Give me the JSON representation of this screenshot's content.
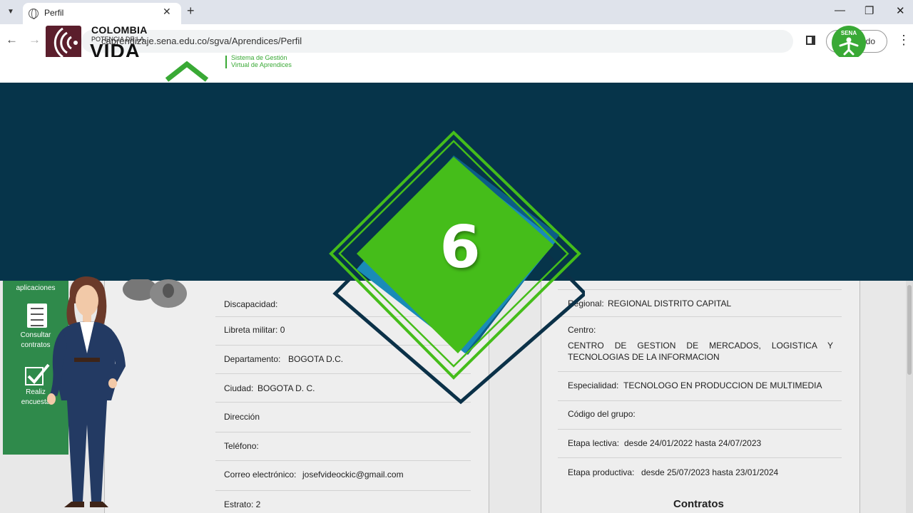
{
  "browser": {
    "tab_title": "Perfil",
    "url": "caprendizaje.sena.edu.co/sgva/Aprendices/Perfil",
    "profile_label": "ado"
  },
  "overlay": {
    "colombia_line1": "COLOMBIA",
    "colombia_line2": "POTENCIA DE LA",
    "colombia_line3": "VIDA",
    "sena_text": "SENA",
    "step_number": "6"
  },
  "header": {
    "sgva_line1": "Sistema de Gestión",
    "sgva_line2": "Virtual de Aprendices"
  },
  "sidebar": {
    "item_top": "aplicaciones",
    "item_contracts_1": "Consultar",
    "item_contracts_2": "contratos",
    "item_survey_1": "Realiz",
    "item_survey_2": "encuesta"
  },
  "left_fields": {
    "discapacidad": "Discapacidad:",
    "libreta": "Libreta militar: 0",
    "departamento_label": "Departamento:",
    "departamento_value": "BOGOTA D.C.",
    "ciudad_label": "Ciudad:",
    "ciudad_value": "BOGOTA D. C.",
    "direccion": "Dirección",
    "telefono": "Teléfono:",
    "correo_label": "Correo electrónico:",
    "correo_value": "josefvideockic@gmail.com",
    "estrato": "Estrato: 2"
  },
  "right_fields": {
    "regional_label": "Regional:",
    "regional_value": "REGIONAL DISTRITO CAPITAL",
    "centro_label": "Centro:",
    "centro_value": "CENTRO DE GESTION DE MERCADOS, LOGISTICA Y TECNOLOGIAS DE LA INFORMACION",
    "especialidad_label": "Especialidad:",
    "especialidad_value": "TECNOLOGO EN PRODUCCION DE MULTIMEDIA",
    "grupo": "Código del grupo:",
    "lectiva_label": "Etapa lectiva:",
    "lectiva_value": "desde 24/01/2022 hasta 24/07/2023",
    "productiva_label": "Etapa productiva:",
    "productiva_value": "desde 25/07/2023 hasta 23/01/2024",
    "contratos_title": "Contratos"
  },
  "colors": {
    "banner": "#06344a",
    "diamond_green": "#45bd1a",
    "sena_green": "#39a935",
    "sidebar_green": "#2f8a4b"
  }
}
